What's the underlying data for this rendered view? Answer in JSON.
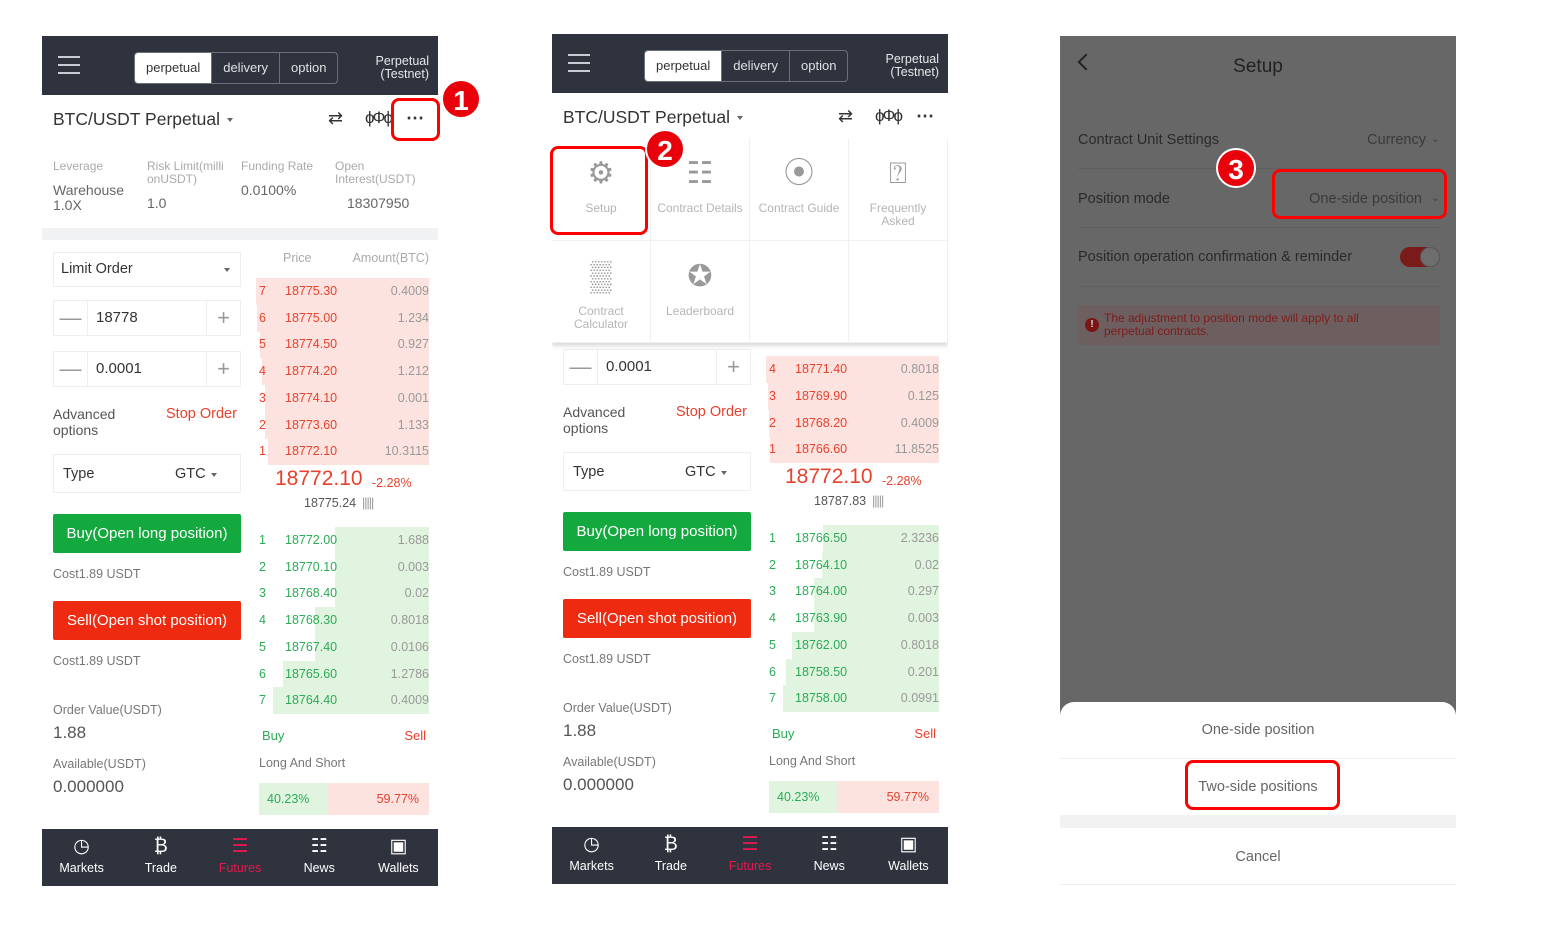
{
  "colors": {
    "ask": "#e8412c",
    "bid": "#2bab55",
    "ask_bg": "#fde3df",
    "bid_bg": "#e1f4df",
    "buy_btn": "#14a93f",
    "sell_btn": "#ee2a10",
    "nav_active": "#e8174f",
    "header": "#2e333d",
    "annotation": "#e8000b"
  },
  "header": {
    "tabs": [
      "perpetual",
      "delivery",
      "option"
    ],
    "active_tab": "perpetual",
    "network_line1": "Perpetual",
    "network_line2": "(Testnet)"
  },
  "nav": [
    {
      "label": "Markets",
      "icon": "markets-icon"
    },
    {
      "label": "Trade",
      "icon": "bitcoin-icon"
    },
    {
      "label": "Futures",
      "icon": "futures-icon",
      "active": true
    },
    {
      "label": "News",
      "icon": "news-icon"
    },
    {
      "label": "Wallets",
      "icon": "wallet-icon"
    }
  ],
  "annotations": [
    "1",
    "2",
    "3"
  ],
  "panel1": {
    "title": "BTC/USDT Perpetual",
    "stats": {
      "leverage_label": "Leverage",
      "leverage_value1": "Warehouse",
      "leverage_value2": "1.0X",
      "risk_label1": "Risk Limit(milli",
      "risk_label2": "onUSDT)",
      "risk_value": "1.0",
      "funding_label": "Funding Rate",
      "funding_value": "0.0100%",
      "oi_label1": "Open",
      "oi_label2": "Interest(USDT)",
      "oi_value": "18307950"
    },
    "order_type": "Limit Order",
    "price": "18778",
    "amount": "0.0001",
    "advanced_1": "Advanced",
    "advanced_2": "options",
    "stop_order": "Stop Order",
    "type_label": "Type",
    "type_value": "GTC",
    "buy_label": "Buy(Open long position)",
    "buy_cost": "Cost1.89 USDT",
    "sell_label": "Sell(Open shot position)",
    "sell_cost": "Cost1.89 USDT",
    "order_value_label": "Order Value(USDT)",
    "order_value": "1.88",
    "available_label": "Available(USDT)",
    "available": "0.000000",
    "ob_price_header": "Price",
    "ob_amount_header": "Amount(BTC)",
    "asks": [
      {
        "n": "7",
        "p": "18775.30",
        "a": "0.4009"
      },
      {
        "n": "6",
        "p": "18775.00",
        "a": "1.234"
      },
      {
        "n": "5",
        "p": "18774.50",
        "a": "0.927"
      },
      {
        "n": "4",
        "p": "18774.20",
        "a": "1.212"
      },
      {
        "n": "3",
        "p": "18774.10",
        "a": "0.001"
      },
      {
        "n": "2",
        "p": "18773.60",
        "a": "1.133"
      },
      {
        "n": "1",
        "p": "18772.10",
        "a": "10.3115"
      }
    ],
    "last_price": "18772.10",
    "change": "-2.28%",
    "mark_price": "18775.24",
    "bids": [
      {
        "n": "1",
        "p": "18772.00",
        "a": "1.688"
      },
      {
        "n": "2",
        "p": "18770.10",
        "a": "0.003"
      },
      {
        "n": "3",
        "p": "18768.40",
        "a": "0.02"
      },
      {
        "n": "4",
        "p": "18768.30",
        "a": "0.8018"
      },
      {
        "n": "5",
        "p": "18767.40",
        "a": "0.0106"
      },
      {
        "n": "6",
        "p": "18765.60",
        "a": "1.2786"
      },
      {
        "n": "7",
        "p": "18764.40",
        "a": "0.4009"
      }
    ],
    "buy": "Buy",
    "sell": "Sell",
    "long_short_label": "Long And Short",
    "long_pct": "40.23%",
    "short_pct": "59.77%",
    "long_fraction": 0.4023
  },
  "panel2": {
    "title": "BTC/USDT Perpetual",
    "menu": [
      {
        "label": "Setup",
        "icon": "gear-icon"
      },
      {
        "label": "Contract Details",
        "icon": "document-icon"
      },
      {
        "label": "Contract Guide",
        "icon": "compass-icon"
      },
      {
        "label": "Frequently Asked",
        "icon": "faq-icon"
      },
      {
        "label": "Contract Calculator",
        "icon": "calculator-icon"
      },
      {
        "label": "Leaderboard",
        "icon": "medal-icon"
      }
    ],
    "amount": "0.0001",
    "advanced_1": "Advanced",
    "advanced_2": "options",
    "stop_order": "Stop Order",
    "type_label": "Type",
    "type_value": "GTC",
    "buy_label": "Buy(Open long position)",
    "buy_cost": "Cost1.89 USDT",
    "sell_label": "Sell(Open shot position)",
    "sell_cost": "Cost1.89 USDT",
    "order_value_label": "Order Value(USDT)",
    "order_value": "1.88",
    "available_label": "Available(USDT)",
    "available": "0.000000",
    "asks": [
      {
        "n": "4",
        "p": "18771.40",
        "a": "0.8018"
      },
      {
        "n": "3",
        "p": "18769.90",
        "a": "0.125"
      },
      {
        "n": "2",
        "p": "18768.20",
        "a": "0.4009"
      },
      {
        "n": "1",
        "p": "18766.60",
        "a": "11.8525"
      }
    ],
    "last_price": "18772.10",
    "change": "-2.28%",
    "mark_price": "18787.83",
    "bids": [
      {
        "n": "1",
        "p": "18766.50",
        "a": "2.3236"
      },
      {
        "n": "2",
        "p": "18764.10",
        "a": "0.02"
      },
      {
        "n": "3",
        "p": "18764.00",
        "a": "0.297"
      },
      {
        "n": "4",
        "p": "18763.90",
        "a": "0.003"
      },
      {
        "n": "5",
        "p": "18762.00",
        "a": "0.8018"
      },
      {
        "n": "6",
        "p": "18758.50",
        "a": "0.201"
      },
      {
        "n": "7",
        "p": "18758.00",
        "a": "0.0991"
      }
    ],
    "buy": "Buy",
    "sell": "Sell",
    "long_short_label": "Long And Short",
    "long_pct": "40.23%",
    "short_pct": "59.77%",
    "long_fraction": 0.4023
  },
  "setup": {
    "title": "Setup",
    "contract_unit_label": "Contract Unit Settings",
    "contract_unit_value": "Currency",
    "position_mode_label": "Position mode",
    "position_mode_value": "One-side position",
    "confirm_label": "Position operation confirmation & reminder",
    "confirm_on": true,
    "notice": "The adjustment to position mode will apply to all perpetual contracts.",
    "sheet": {
      "option1": "One-side position",
      "option2": "Two-side positions",
      "cancel": "Cancel"
    }
  }
}
